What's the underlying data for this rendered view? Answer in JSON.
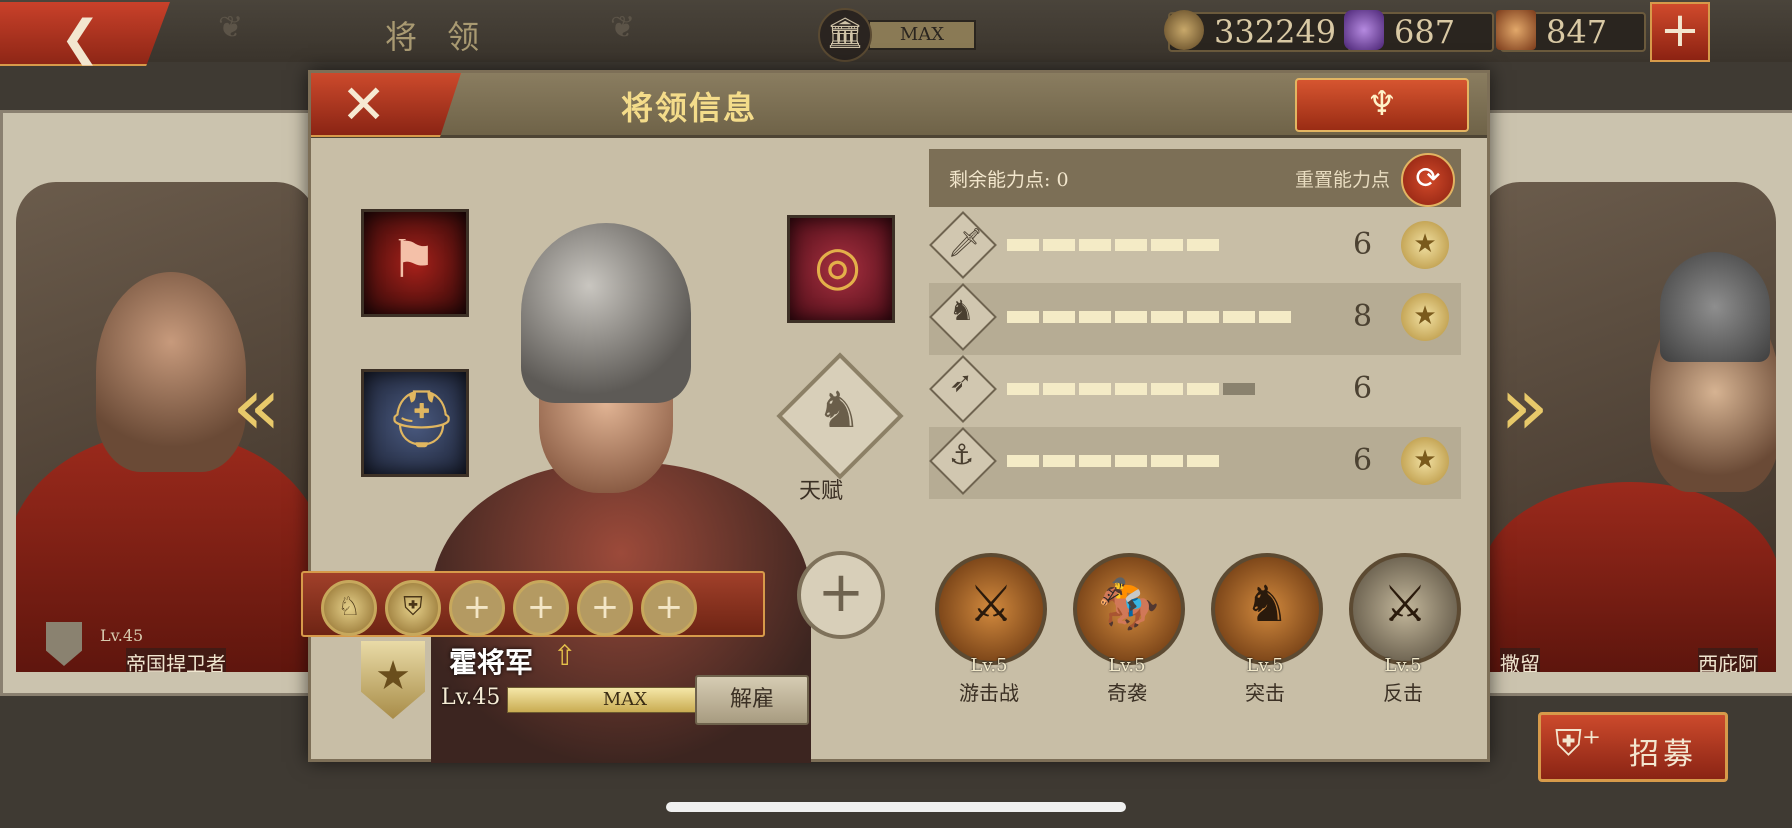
{
  "header": {
    "title": "将 领",
    "building_level": "MAX",
    "coins": "332249",
    "gems": "687",
    "honor": "847",
    "icons": {
      "back": "chevron-left-icon",
      "bank": "temple-icon",
      "coin": "coin-icon",
      "gem": "gem-icon",
      "honor": "spqr-icon",
      "add": "plus-icon"
    }
  },
  "side_generals": {
    "left": {
      "name": "帝国捍卫者",
      "level": "Lv.45"
    },
    "right_a": {
      "name": "撒留"
    },
    "right_b": {
      "name": "西庇阿"
    }
  },
  "modal": {
    "title": "将领信息",
    "talent_label": "天赋",
    "general": {
      "name": "霍将军",
      "level": "Lv.45",
      "xp": "MAX",
      "xp_progress": 1.0
    },
    "dismiss_label": "解雇",
    "stats": {
      "remaining_label": "剩余能力点: 0",
      "reset_label": "重置能力点",
      "rows": [
        {
          "icon": "sword-icon",
          "value": "6",
          "segments": 6,
          "extra": 0,
          "starred": true
        },
        {
          "icon": "horse-icon",
          "value": "8",
          "segments": 8,
          "extra": 0,
          "starred": true
        },
        {
          "icon": "bow-icon",
          "value": "6",
          "segments": 6,
          "extra": 1,
          "starred": false
        },
        {
          "icon": "anchor-icon",
          "value": "6",
          "segments": 6,
          "extra": 0,
          "starred": true
        }
      ]
    },
    "skills": [
      {
        "name": "游击战",
        "level": "Lv.5"
      },
      {
        "name": "奇袭",
        "level": "Lv.5"
      },
      {
        "name": "突击",
        "level": "Lv.5"
      },
      {
        "name": "反击",
        "level": "Lv.5"
      }
    ]
  },
  "recruit_label": "招募",
  "colors": {
    "accent_red": "#b7381f",
    "gold": "#d79a4a",
    "panel": "#c8bea6"
  }
}
